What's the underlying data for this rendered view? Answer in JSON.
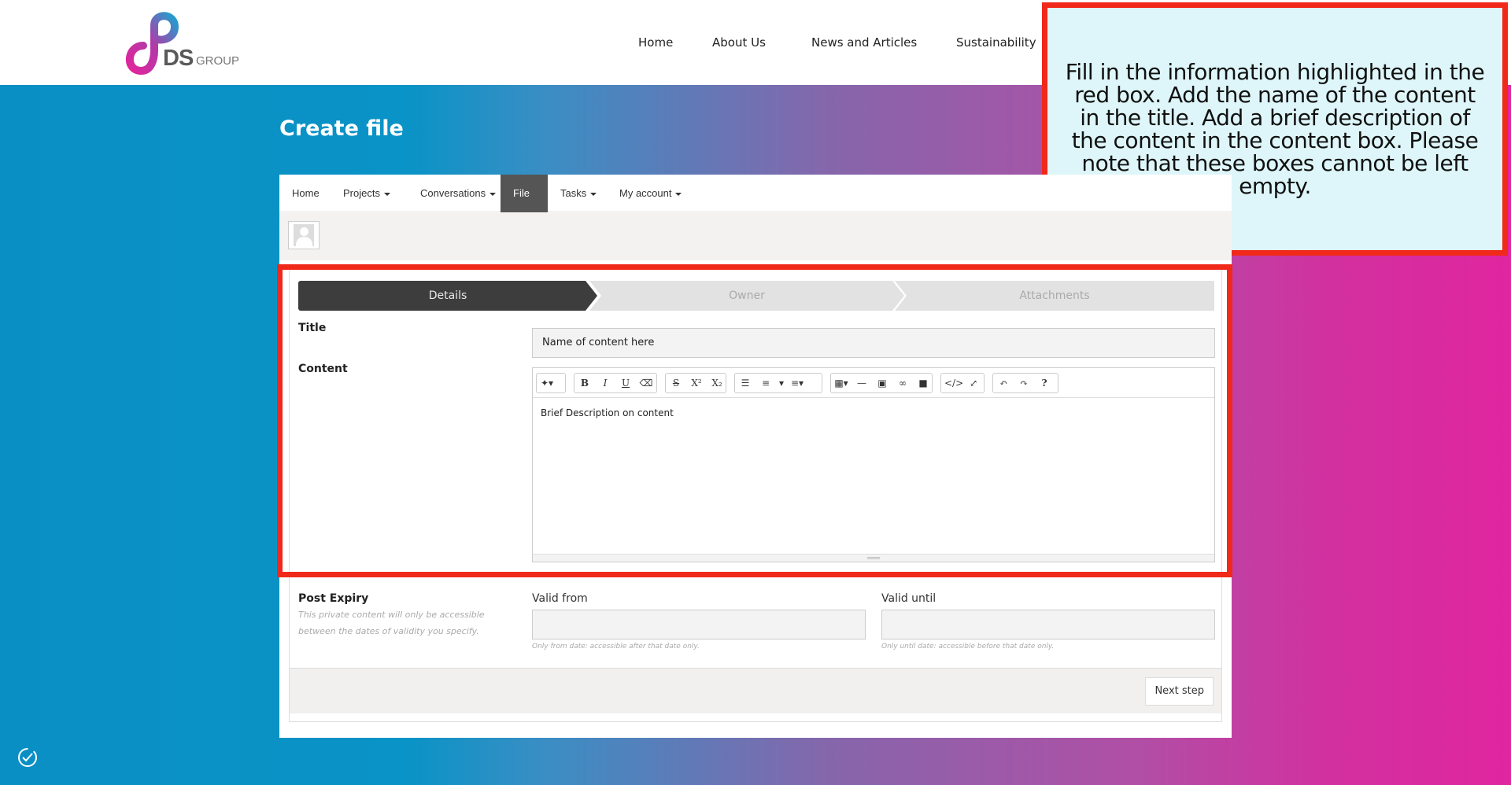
{
  "logo": {
    "ds": "DS",
    "group": "GROUP"
  },
  "topnav": [
    {
      "label": "Home"
    },
    {
      "label": "About Us"
    },
    {
      "label": "News and Articles"
    },
    {
      "label": "Sustainability"
    }
  ],
  "callout": {
    "text": "Fill in the information highlighted in the red box. Add the name of the content in the title. Add a brief description of the content in the content box. Please note that these boxes cannot be left empty."
  },
  "page": {
    "title": "Create file"
  },
  "menu": [
    {
      "label": "Home"
    },
    {
      "label": "Projects"
    },
    {
      "label": "Conversations"
    },
    {
      "label": "File"
    },
    {
      "label": "Tasks"
    },
    {
      "label": "My account"
    }
  ],
  "steps": [
    {
      "label": "Details"
    },
    {
      "label": "Owner"
    },
    {
      "label": "Attachments"
    }
  ],
  "form": {
    "title_label": "Title",
    "title_value": "Name of content here",
    "content_label": "Content",
    "content_value": "Brief Description on content",
    "post_expiry_label": "Post Expiry",
    "post_expiry_hint": "This private content will only be accessible between the dates of validity you specify.",
    "valid_from_label": "Valid from",
    "valid_from_hint": "Only from date: accessible after that date only.",
    "valid_until_label": "Valid until",
    "valid_until_hint": "Only until date: accessible before that date only.",
    "next_button": "Next step"
  },
  "toolbar": {
    "bold": "B",
    "italic": "I",
    "underline": "U",
    "strike": "S",
    "superscript": "X²",
    "subscript": "X₂",
    "help": "?"
  },
  "colors": {
    "accent_red": "#f0291b",
    "callout_bg": "#def6f9",
    "active_tab": "#555555"
  }
}
